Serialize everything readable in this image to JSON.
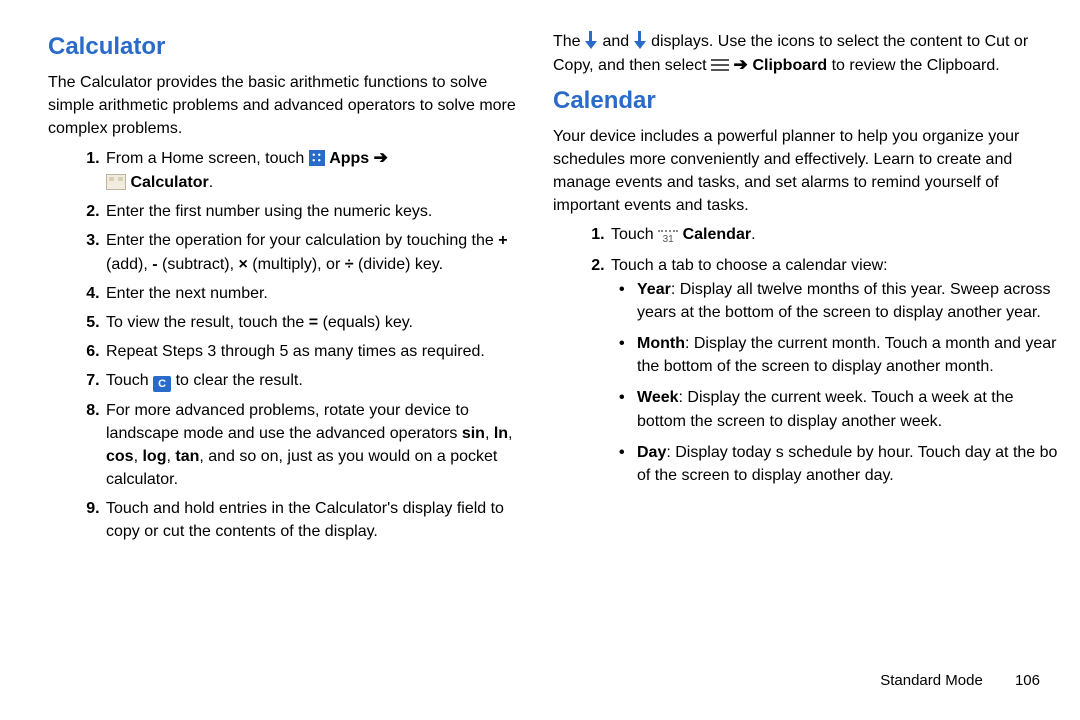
{
  "left": {
    "heading": "Calculator",
    "intro": "The Calculator provides the basic arithmetic functions to solve simple arithmetic problems and advanced operators to solve more complex problems.",
    "step1_a": "From a Home screen, touch ",
    "step1_apps": " Apps ",
    "step1_calc": " Calculator",
    "step1_dot": ".",
    "step2": "Enter the first number using the numeric keys.",
    "step3_a": "Enter the operation for your calculation by touching the ",
    "step3_plus": "+",
    "step3_b": " (add), ",
    "step3_minus": "-",
    "step3_c": " (subtract), ",
    "step3_mul": "×",
    "step3_d": " (multiply), or ",
    "step3_div": "÷",
    "step3_e": " (divide) key.",
    "step4": "Enter the next number.",
    "step5_a": "To view the result, touch the ",
    "step5_eq": "=",
    "step5_b": " (equals) key.",
    "step6": "Repeat Steps 3 through 5 as many times as required.",
    "step7_a": "Touch ",
    "step7_c": "C",
    "step7_b": " to clear the result.",
    "step8_a": "For more advanced problems, rotate your device to landscape mode and use the advanced operators ",
    "step8_sin": "sin",
    "step8_c1": ", ",
    "step8_ln": "ln",
    "step8_c2": ", ",
    "step8_cos": "cos",
    "step8_c3": ", ",
    "step8_log": "log",
    "step8_c4": ", ",
    "step8_tan": "tan",
    "step8_b": ", and so on, just as you would on a pocket calculator.",
    "step9": "Touch and hold entries in the Calculator's display field to copy or cut the contents of the display."
  },
  "right": {
    "top_a": "The ",
    "top_b": " and ",
    "top_c": " displays. Use the icons to select the content to Cut or Copy, and then select ",
    "arrow": " ➔ ",
    "top_clip": "Clipboard",
    "top_d": " to review the Clipboard.",
    "heading": "Calendar",
    "intro": "Your device includes a powerful planner to help you organize your schedules more conveniently and effectively. Learn to create and manage events and tasks, and set alarms to remind yourself of important events and tasks.",
    "s1_a": "Touch ",
    "cal_num": "31",
    "s1_cal": " Calendar",
    "s1_dot": ".",
    "s2": "Touch a tab to choose a calendar view:",
    "b1_t": "Year",
    "b1": ": Display all twelve months of this year. Sweep across years at the bottom of the screen to display another year.",
    "b2_t": "Month",
    "b2": ": Display the current month. Touch a month and year the bottom of the screen to display another month.",
    "b3_t": "Week",
    "b3": ": Display the current week. Touch a week at the bottom the screen to display another week.",
    "b4_t": "Day",
    "b4": ": Display today s schedule by hour. Touch day at the bo of the screen to display another day."
  },
  "footer": {
    "mode": "Standard Mode",
    "page": "106"
  },
  "arrow": "➔"
}
